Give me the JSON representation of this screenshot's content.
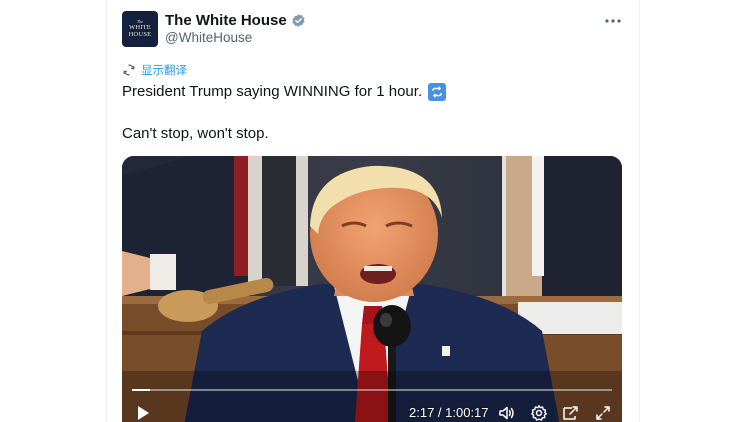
{
  "account": {
    "display_name": "The White House",
    "handle": "@WhiteHouse",
    "avatar_text_small": "The",
    "avatar_text_line1": "WHITE",
    "avatar_text_line2": "HOUSE",
    "verified_color": "#829aab"
  },
  "translate": {
    "label": "显示翻译"
  },
  "tweet": {
    "line1": "President Trump saying WINNING for 1 hour.",
    "line1_emoji": "repeat-button-emoji",
    "line2": "Can't stop, won't stop."
  },
  "video": {
    "time": "2:17 / 1:00:17",
    "progress_fraction": 0.038,
    "icons": [
      "play-icon",
      "volume-icon",
      "settings-icon",
      "picture-in-picture-icon",
      "fullscreen-icon"
    ]
  },
  "colors": {
    "link": "#1d9bf0",
    "text": "#0f1419",
    "secondary": "#536471"
  }
}
